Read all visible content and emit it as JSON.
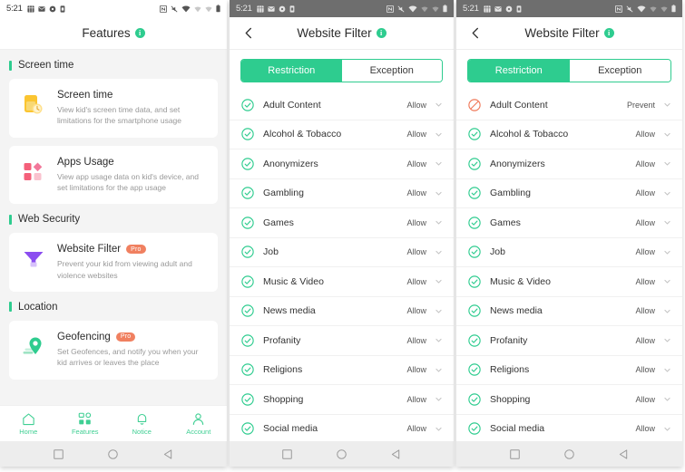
{
  "statusbar": {
    "time": "5:21",
    "left_icons": [
      "calendar-icon",
      "mail-icon",
      "location-icon",
      "sim-icon"
    ],
    "right_icons": [
      "nfc-icon",
      "mute-icon",
      "wifi-icon",
      "signal-one-icon",
      "signal-two-icon",
      "battery-icon"
    ]
  },
  "colors": {
    "accent_green": "#2ecc8f",
    "pro_badge": "#f08060",
    "prevent_red": "#f0795a",
    "text_dark": "#2b2b2b",
    "text_muted": "#999999",
    "page_bg": "#f4f4f4",
    "statusbar_dark": "#6e6e6e",
    "androidnav_bg": "#ededed"
  },
  "panel1": {
    "title": "Features",
    "info_glyph": "i",
    "sections": [
      {
        "heading": "Screen time",
        "cards": [
          {
            "icon": "screen-time-icon",
            "title": "Screen time",
            "pro": null,
            "desc": "View kid's screen time data, and set limitations for the smartphone usage"
          },
          {
            "icon": "apps-usage-icon",
            "title": "Apps Usage",
            "pro": null,
            "desc": "View app usage data on kid's device, and set limitations for the app usage"
          }
        ]
      },
      {
        "heading": "Web Security",
        "cards": [
          {
            "icon": "website-filter-icon",
            "title": "Website Filter",
            "pro": "Pro",
            "desc": "Prevent your kid from viewing adult and violence websites"
          }
        ]
      },
      {
        "heading": "Location",
        "cards": [
          {
            "icon": "geofencing-icon",
            "title": "Geofencing",
            "pro": "Pro",
            "desc": "Set Geofences, and notify you when your kid arrives or leaves the place"
          }
        ]
      }
    ],
    "bottom_nav": [
      {
        "icon": "home-icon",
        "label": "Home"
      },
      {
        "icon": "features-grid-icon",
        "label": "Features"
      },
      {
        "icon": "bell-icon",
        "label": "Notice"
      },
      {
        "icon": "account-icon",
        "label": "Account"
      }
    ]
  },
  "panel2": {
    "back_icon": "chevron-left-icon",
    "title": "Website Filter",
    "info_glyph": "i",
    "tabs": [
      {
        "label": "Restriction",
        "active": true
      },
      {
        "label": "Exception",
        "active": false
      }
    ],
    "rows": [
      {
        "label": "Adult Content",
        "state": "Allow",
        "status": "allow"
      },
      {
        "label": "Alcohol & Tobacco",
        "state": "Allow",
        "status": "allow"
      },
      {
        "label": "Anonymizers",
        "state": "Allow",
        "status": "allow"
      },
      {
        "label": "Gambling",
        "state": "Allow",
        "status": "allow"
      },
      {
        "label": "Games",
        "state": "Allow",
        "status": "allow"
      },
      {
        "label": "Job",
        "state": "Allow",
        "status": "allow"
      },
      {
        "label": "Music & Video",
        "state": "Allow",
        "status": "allow"
      },
      {
        "label": "News media",
        "state": "Allow",
        "status": "allow"
      },
      {
        "label": "Profanity",
        "state": "Allow",
        "status": "allow"
      },
      {
        "label": "Religions",
        "state": "Allow",
        "status": "allow"
      },
      {
        "label": "Shopping",
        "state": "Allow",
        "status": "allow"
      },
      {
        "label": "Social media",
        "state": "Allow",
        "status": "allow"
      }
    ]
  },
  "panel3": {
    "back_icon": "chevron-left-icon",
    "title": "Website Filter",
    "info_glyph": "i",
    "tabs": [
      {
        "label": "Restriction",
        "active": true
      },
      {
        "label": "Exception",
        "active": false
      }
    ],
    "rows": [
      {
        "label": "Adult Content",
        "state": "Prevent",
        "status": "prevent"
      },
      {
        "label": "Alcohol & Tobacco",
        "state": "Allow",
        "status": "allow"
      },
      {
        "label": "Anonymizers",
        "state": "Allow",
        "status": "allow"
      },
      {
        "label": "Gambling",
        "state": "Allow",
        "status": "allow"
      },
      {
        "label": "Games",
        "state": "Allow",
        "status": "allow"
      },
      {
        "label": "Job",
        "state": "Allow",
        "status": "allow"
      },
      {
        "label": "Music & Video",
        "state": "Allow",
        "status": "allow"
      },
      {
        "label": "News media",
        "state": "Allow",
        "status": "allow"
      },
      {
        "label": "Profanity",
        "state": "Allow",
        "status": "allow"
      },
      {
        "label": "Religions",
        "state": "Allow",
        "status": "allow"
      },
      {
        "label": "Shopping",
        "state": "Allow",
        "status": "allow"
      },
      {
        "label": "Social media",
        "state": "Allow",
        "status": "allow"
      }
    ]
  },
  "android_nav": [
    {
      "icon": "recents-square-icon"
    },
    {
      "icon": "home-circle-icon"
    },
    {
      "icon": "back-triangle-icon"
    }
  ]
}
